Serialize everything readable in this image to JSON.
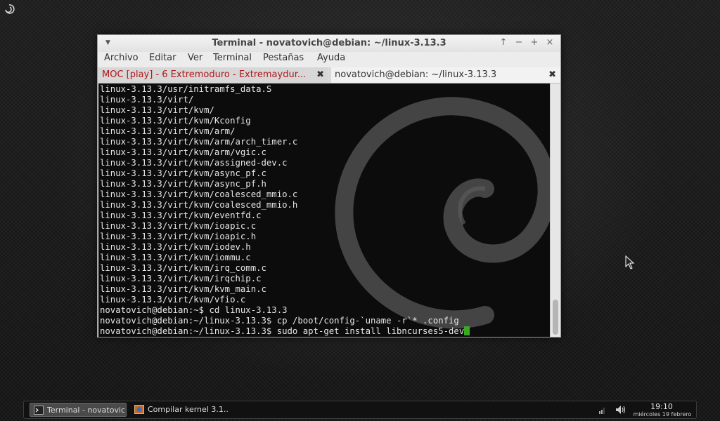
{
  "window": {
    "title": "Terminal - novatovich@debian: ~/linux-3.13.3",
    "controls": {
      "above": "↑",
      "minimize": "−",
      "maximize": "+",
      "close": "×"
    }
  },
  "menubar": [
    "Archivo",
    "Editar",
    "Ver",
    "Terminal",
    "Pestañas",
    "Ayuda"
  ],
  "tabs": [
    {
      "label": "MOC [play] - 6 Extremoduro - Extremaydur...",
      "close": "✖"
    },
    {
      "label": "novatovich@debian: ~/linux-3.13.3",
      "close": "✖"
    }
  ],
  "terminal": {
    "lines": [
      "linux-3.13.3/usr/initramfs_data.S",
      "linux-3.13.3/virt/",
      "linux-3.13.3/virt/kvm/",
      "linux-3.13.3/virt/kvm/Kconfig",
      "linux-3.13.3/virt/kvm/arm/",
      "linux-3.13.3/virt/kvm/arm/arch_timer.c",
      "linux-3.13.3/virt/kvm/arm/vgic.c",
      "linux-3.13.3/virt/kvm/assigned-dev.c",
      "linux-3.13.3/virt/kvm/async_pf.c",
      "linux-3.13.3/virt/kvm/async_pf.h",
      "linux-3.13.3/virt/kvm/coalesced_mmio.c",
      "linux-3.13.3/virt/kvm/coalesced_mmio.h",
      "linux-3.13.3/virt/kvm/eventfd.c",
      "linux-3.13.3/virt/kvm/ioapic.c",
      "linux-3.13.3/virt/kvm/ioapic.h",
      "linux-3.13.3/virt/kvm/iodev.h",
      "linux-3.13.3/virt/kvm/iommu.c",
      "linux-3.13.3/virt/kvm/irq_comm.c",
      "linux-3.13.3/virt/kvm/irqchip.c",
      "linux-3.13.3/virt/kvm/kvm_main.c",
      "linux-3.13.3/virt/kvm/vfio.c",
      "novatovich@debian:~$ cd linux-3.13.3",
      "novatovich@debian:~/linux-3.13.3$ cp /boot/config-`uname -r`* .config"
    ],
    "prompt": "novatovich@debian:~/linux-3.13.3$ sudo apt-get install libncurses5-dev",
    "cursor_color": "#3aa825"
  },
  "taskbar": {
    "tasks": [
      {
        "label": "Terminal - novatovic...",
        "icon": "terminal-icon",
        "active": true
      },
      {
        "label": "Compilar kernel 3.1...",
        "icon": "browser-icon",
        "active": false
      }
    ],
    "clock": {
      "time": "19:10",
      "date": "miércoles 19 febrero"
    }
  },
  "colors": {
    "tab_playing": "#b0161b",
    "terminal_bg": "#0c0c0c"
  }
}
